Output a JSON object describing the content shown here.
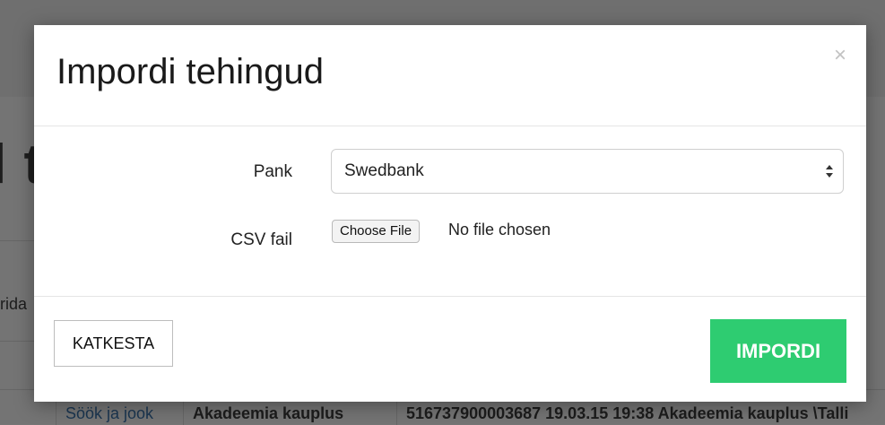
{
  "background": {
    "heading_fragment": "l t",
    "side_label_fragment": "rida",
    "row": {
      "category": "Söök ja jook",
      "merchant": "Akadeemia kauplus",
      "description": "516737900003687 19.03.15 19:38 Akadeemia kauplus \\Talli"
    }
  },
  "modal": {
    "title": "Impordi tehingud",
    "close_symbol": "×",
    "bank_label": "Pank",
    "bank_selected": "Swedbank",
    "csv_label": "CSV fail",
    "file_button_label": "Choose File",
    "file_status": "No file chosen",
    "cancel_label": "KATKESTA",
    "import_label": "IMPORDI"
  },
  "colors": {
    "primary_button": "#2ecc71",
    "overlay": "#747474"
  },
  "icons": {
    "close": "close-icon",
    "select_arrows": "sort-arrows-icon"
  }
}
